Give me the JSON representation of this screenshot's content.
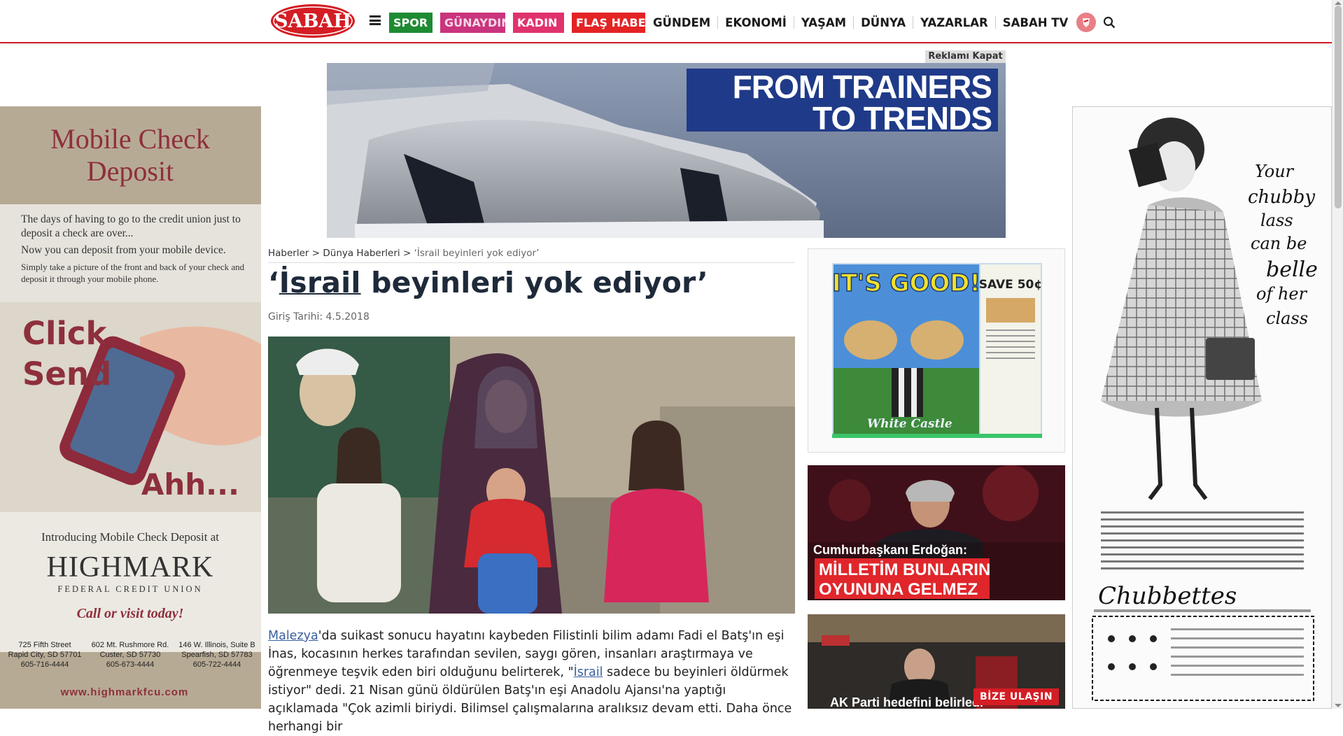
{
  "header": {
    "logo_text": "SABAH",
    "pills": [
      {
        "label": "SPOR"
      },
      {
        "label": "GÜNAYDIN"
      },
      {
        "label": "KADIN"
      },
      {
        "label": "FLAŞ HABER"
      }
    ],
    "links": [
      "GÜNDEM",
      "EKONOMİ",
      "YAŞAM",
      "DÜNYA",
      "YAZARLAR",
      "SABAH TV"
    ],
    "colors": {
      "brand_red": "#d41d24",
      "spor": "#1e8b33",
      "gunaydin": "#c9347d",
      "kadin": "#e0336e",
      "flas": "#e42324"
    }
  },
  "ads": {
    "close_label": "Reklamı Kapat",
    "top_banner": {
      "headline_1": "FROM TRAINERS",
      "headline_2": "TO TRENDS"
    },
    "left": {
      "title_1": "Mobile Check",
      "title_2": "Deposit",
      "p1": "The days of having to go to the credit union just to deposit a check are over...",
      "p2": "Now you can deposit from your mobile device.",
      "p3": "Simply take a picture of the front and back of your check and deposit it through your mobile phone.",
      "click": "Click",
      "send": "Send",
      "ahh": "Ahh...",
      "intro": "Introducing Mobile Check Deposit at",
      "brand": "HIGHMARK",
      "brand_sub": "FEDERAL CREDIT UNION",
      "cta": "Call or visit today!",
      "branches": [
        {
          "l1": "725 Fifth Street",
          "l2": "Rapid City, SD 57701",
          "l3": "605-716-4444"
        },
        {
          "l1": "602 Mt. Rushmore Rd.",
          "l2": "Custer, SD 57730",
          "l3": "605-673-4444"
        },
        {
          "l1": "146 W. Illinois, Suite B",
          "l2": "Spearfish, SD 57783",
          "l3": "605-722-4444"
        }
      ],
      "url": "www.highmarkfcu.com"
    },
    "right": {
      "script_1": "Your",
      "script_2": "chubby",
      "script_3": "lass",
      "script_4": "can be",
      "script_5": "belle",
      "script_6": "of her",
      "script_7": "class",
      "brand": "Chubbettes"
    },
    "rc": {
      "headline": "IT'S GOOD!",
      "save": "SAVE 50¢",
      "brand": "White Castle"
    }
  },
  "article": {
    "breadcrumb": {
      "home": "Haberler",
      "sep": ">",
      "section": "Dünya Haberleri",
      "current": "‘İsrail beyinleri yok ediyor’"
    },
    "title_open": "‘",
    "title_link": "İsrail",
    "title_rest": " beyinleri yok ediyor’",
    "date": "Giriş Tarihi: 4.5.2018",
    "body_link_1": "Malezya",
    "body_1": "'da suikast sonucu hayatını kaybeden Filistinli bilim adamı Fadi el Batş'ın eşi İnas, kocasının herkes tarafından sevilen, saygı gören, insanları araştırmaya ve öğrenmeye teşvik eden biri olduğunu belirterek, \"",
    "body_link_2": "İsrail",
    "body_2": " sadece bu beyinleri öldürmek istiyor\" dedi. 21 Nisan günü öldürülen Batş'ın eşi Anadolu Ajansı'na yaptığı açıklamada \"Çok azimli biriydi. Bilimsel çalışmalarına aralıksız devam etti. Daha önce herhangi bir"
  },
  "sidebar": {
    "news1": {
      "kicker": "Cumhurbaşkanı Erdoğan:",
      "line1": "MİLLETİM BUNLARIN",
      "line2": "OYUNUNA GELMEZ"
    },
    "news2": {
      "headline": "AK Parti hedefini belirledi"
    },
    "contact": "BİZE ULAŞIN"
  }
}
